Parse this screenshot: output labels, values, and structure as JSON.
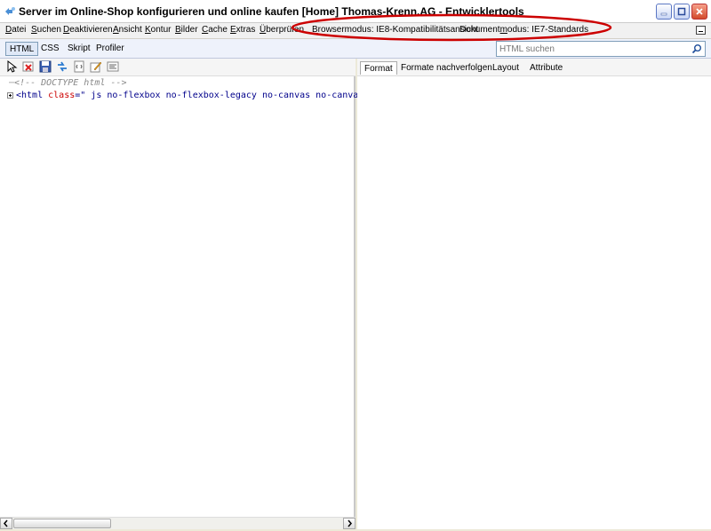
{
  "window": {
    "title": "Server im Online-Shop konfigurieren und online kaufen [Home] Thomas-Krenn.AG - Entwicklertools"
  },
  "menu": {
    "items": [
      {
        "label": "Datei",
        "underline": "D",
        "rest": "atei"
      },
      {
        "label": "Suchen",
        "underline": "S",
        "rest": "uchen"
      },
      {
        "label": "Deaktivieren",
        "underline": "D",
        "rest": "eaktivieren"
      },
      {
        "label": "Ansicht",
        "underline": "A",
        "rest": "nsicht"
      },
      {
        "label": "Kontur",
        "underline": "K",
        "rest": "ontur"
      },
      {
        "label": "Bilder",
        "underline": "B",
        "rest": "ilder"
      },
      {
        "label": "Cache",
        "underline": "C",
        "rest": "ache"
      },
      {
        "label": "Extras",
        "underline": "E",
        "rest": "xtras"
      },
      {
        "label": "Überprüfen",
        "underline": "Ü",
        "rest": "berprüfen"
      }
    ],
    "browser_mode": {
      "underline": "B",
      "rest": "rowsermodus: IE8-Kompatibilitätsansicht"
    },
    "document_mode": {
      "pre": "Dokument",
      "underline": "m",
      "rest": "odus: IE7-Standards"
    }
  },
  "tabs": [
    {
      "label": "HTML",
      "active": true
    },
    {
      "label": "CSS",
      "active": false
    },
    {
      "label": "Skript",
      "active": false
    },
    {
      "label": "Profiler",
      "active": false
    }
  ],
  "search": {
    "placeholder": "HTML suchen"
  },
  "toolbar": {
    "icons": [
      "select-element-icon",
      "clear-icon",
      "save-icon",
      "refresh-icon",
      "dom-view-icon",
      "edit-icon",
      "word-wrap-icon"
    ]
  },
  "dom_tree": {
    "doctype": "<!-- DOCTYPE html -->",
    "html_open": "<html",
    "html_attr": " class",
    "html_eq": "=\"",
    "html_value": " js no-flexbox no-flexbox-legacy no-canvas no-canvastex"
  },
  "right_tabs": [
    {
      "label": "Format",
      "active": true
    },
    {
      "label": "Formate nachverfolgen",
      "active": false
    },
    {
      "label": "Layout",
      "active": false
    },
    {
      "label": "Attribute",
      "active": false
    }
  ],
  "colors": {
    "annotation": "#cc0000",
    "tag": "#00008b",
    "attribute": "#cc0000"
  }
}
